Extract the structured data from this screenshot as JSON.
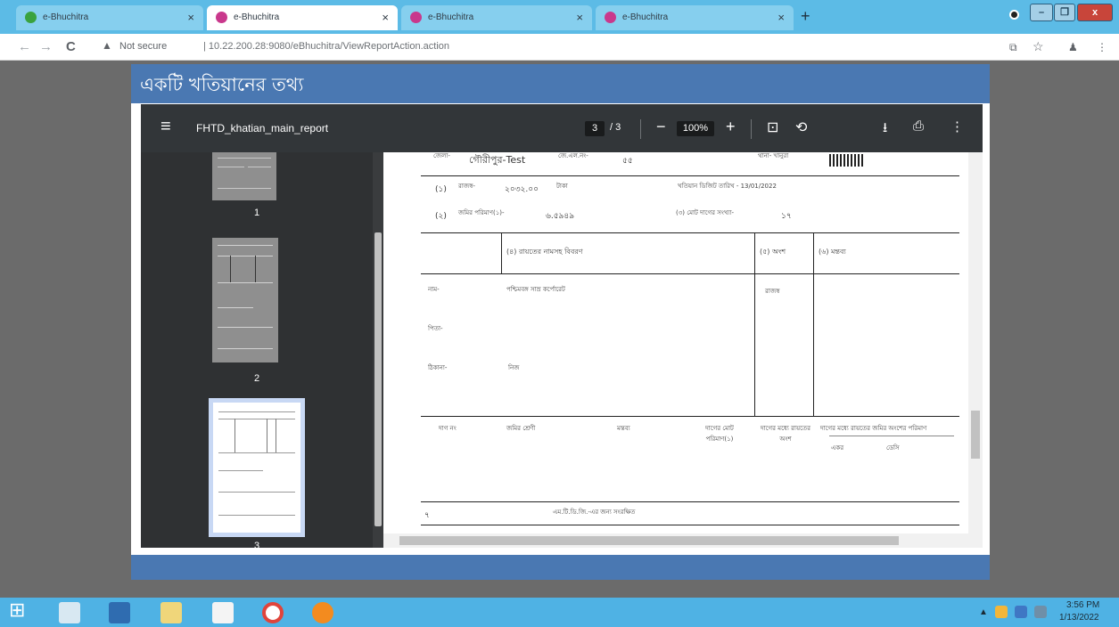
{
  "browser": {
    "tabs": [
      {
        "title": "e-Bhuchitra",
        "close": "×",
        "active": false
      },
      {
        "title": "e-Bhuchitra",
        "close": "×",
        "active": true
      },
      {
        "title": "e-Bhuchitra",
        "close": "×",
        "active": false
      },
      {
        "title": "e-Bhuchitra",
        "close": "×",
        "active": false
      }
    ],
    "new_tab": "+",
    "window_buttons": {
      "minimize": "–",
      "restore": "❐",
      "close": "x"
    },
    "back": "←",
    "forward": "→",
    "reload": "C",
    "security_icon": "▲",
    "security_text": "Not secure",
    "url": "| 10.22.200.28:9080/eBhuchitra/ViewReportAction.action",
    "translate_icon": "⧉",
    "bookmark_icon": "☆",
    "profile_icon": "♟",
    "menu_icon": "⋮"
  },
  "page": {
    "title": "একটি খতিয়ানের তথ্য"
  },
  "viewer": {
    "menu_icon": "≡",
    "file_name": "FHTD_khatian_main_report",
    "page_current": "3",
    "page_total": "/ 3",
    "zoom_out": "−",
    "zoom": "100%",
    "zoom_in": "+",
    "fit_icon": "⊡",
    "rotate_icon": "⟲",
    "download_icon": "⭳",
    "print_icon": "⎙",
    "more_icon": "⋮",
    "thumbnails": [
      "1",
      "2",
      "3"
    ]
  },
  "document": {
    "row0": {
      "label_left": "জেলা-",
      "district": "গৌরীপুর-Test",
      "jl_label": "জে.এল.নং-",
      "jl_value": "৫৫",
      "thana_label": "থানা- খানুরা"
    },
    "row1": {
      "index": "(১)",
      "label": "রাজস্ব-",
      "value": "২০৩২.০০",
      "unit": "টাকা",
      "date_label": "খতিয়ান ডিজিট তারিখ - 13/01/2022"
    },
    "row2": {
      "index": "(২)",
      "label": "জমির পরিমাণ(১)-",
      "value": "৬.৫৯৪৯",
      "plot_label": "(৩) মোট দাগের সংখ্যা-",
      "plot_value": "১৭"
    },
    "header_cols": {
      "c4": "(৪)   রায়তের নামসহ বিবরণ",
      "c5": "(৫)   অংশ",
      "c6": "(৬)   মন্তব্য"
    },
    "owner": {
      "name_label": "নাম-",
      "name_value": "পশ্চিমবঙ্গ সাম্র কর্পোরেট",
      "share": "রাজস্ব",
      "father_label": "পিতা-",
      "address_label": "ঠিকানা-",
      "address_value": "নিজ"
    },
    "plot_table": {
      "cols": [
        "দাগ নং",
        "জমির শ্রেণী",
        "মন্তব্য",
        "দাগের মোট পরিমাণ(১)",
        "দাগের মধ্যে রায়তের অংশ",
        "দাগের মধ্যে রায়তের জমির অংশের পরিমাণ"
      ],
      "sub_cols": [
        "একর",
        "ডেসি"
      ]
    },
    "footer": {
      "page_index": "৭",
      "note": "এম.টি.ডি.জি.-এর জন্য সংরক্ষিত"
    }
  },
  "taskbar": {
    "start_icon": "⊞",
    "clock_time": "3:56 PM",
    "clock_date": "1/13/2022",
    "tray_arrow": "▲"
  },
  "colors": {
    "tabbar": "#5cbbe6",
    "page_header": "#4a78b2",
    "viewer_toolbar": "#323639",
    "viewer_sidebar": "#2f3133",
    "taskbar": "#4fb2e4"
  }
}
